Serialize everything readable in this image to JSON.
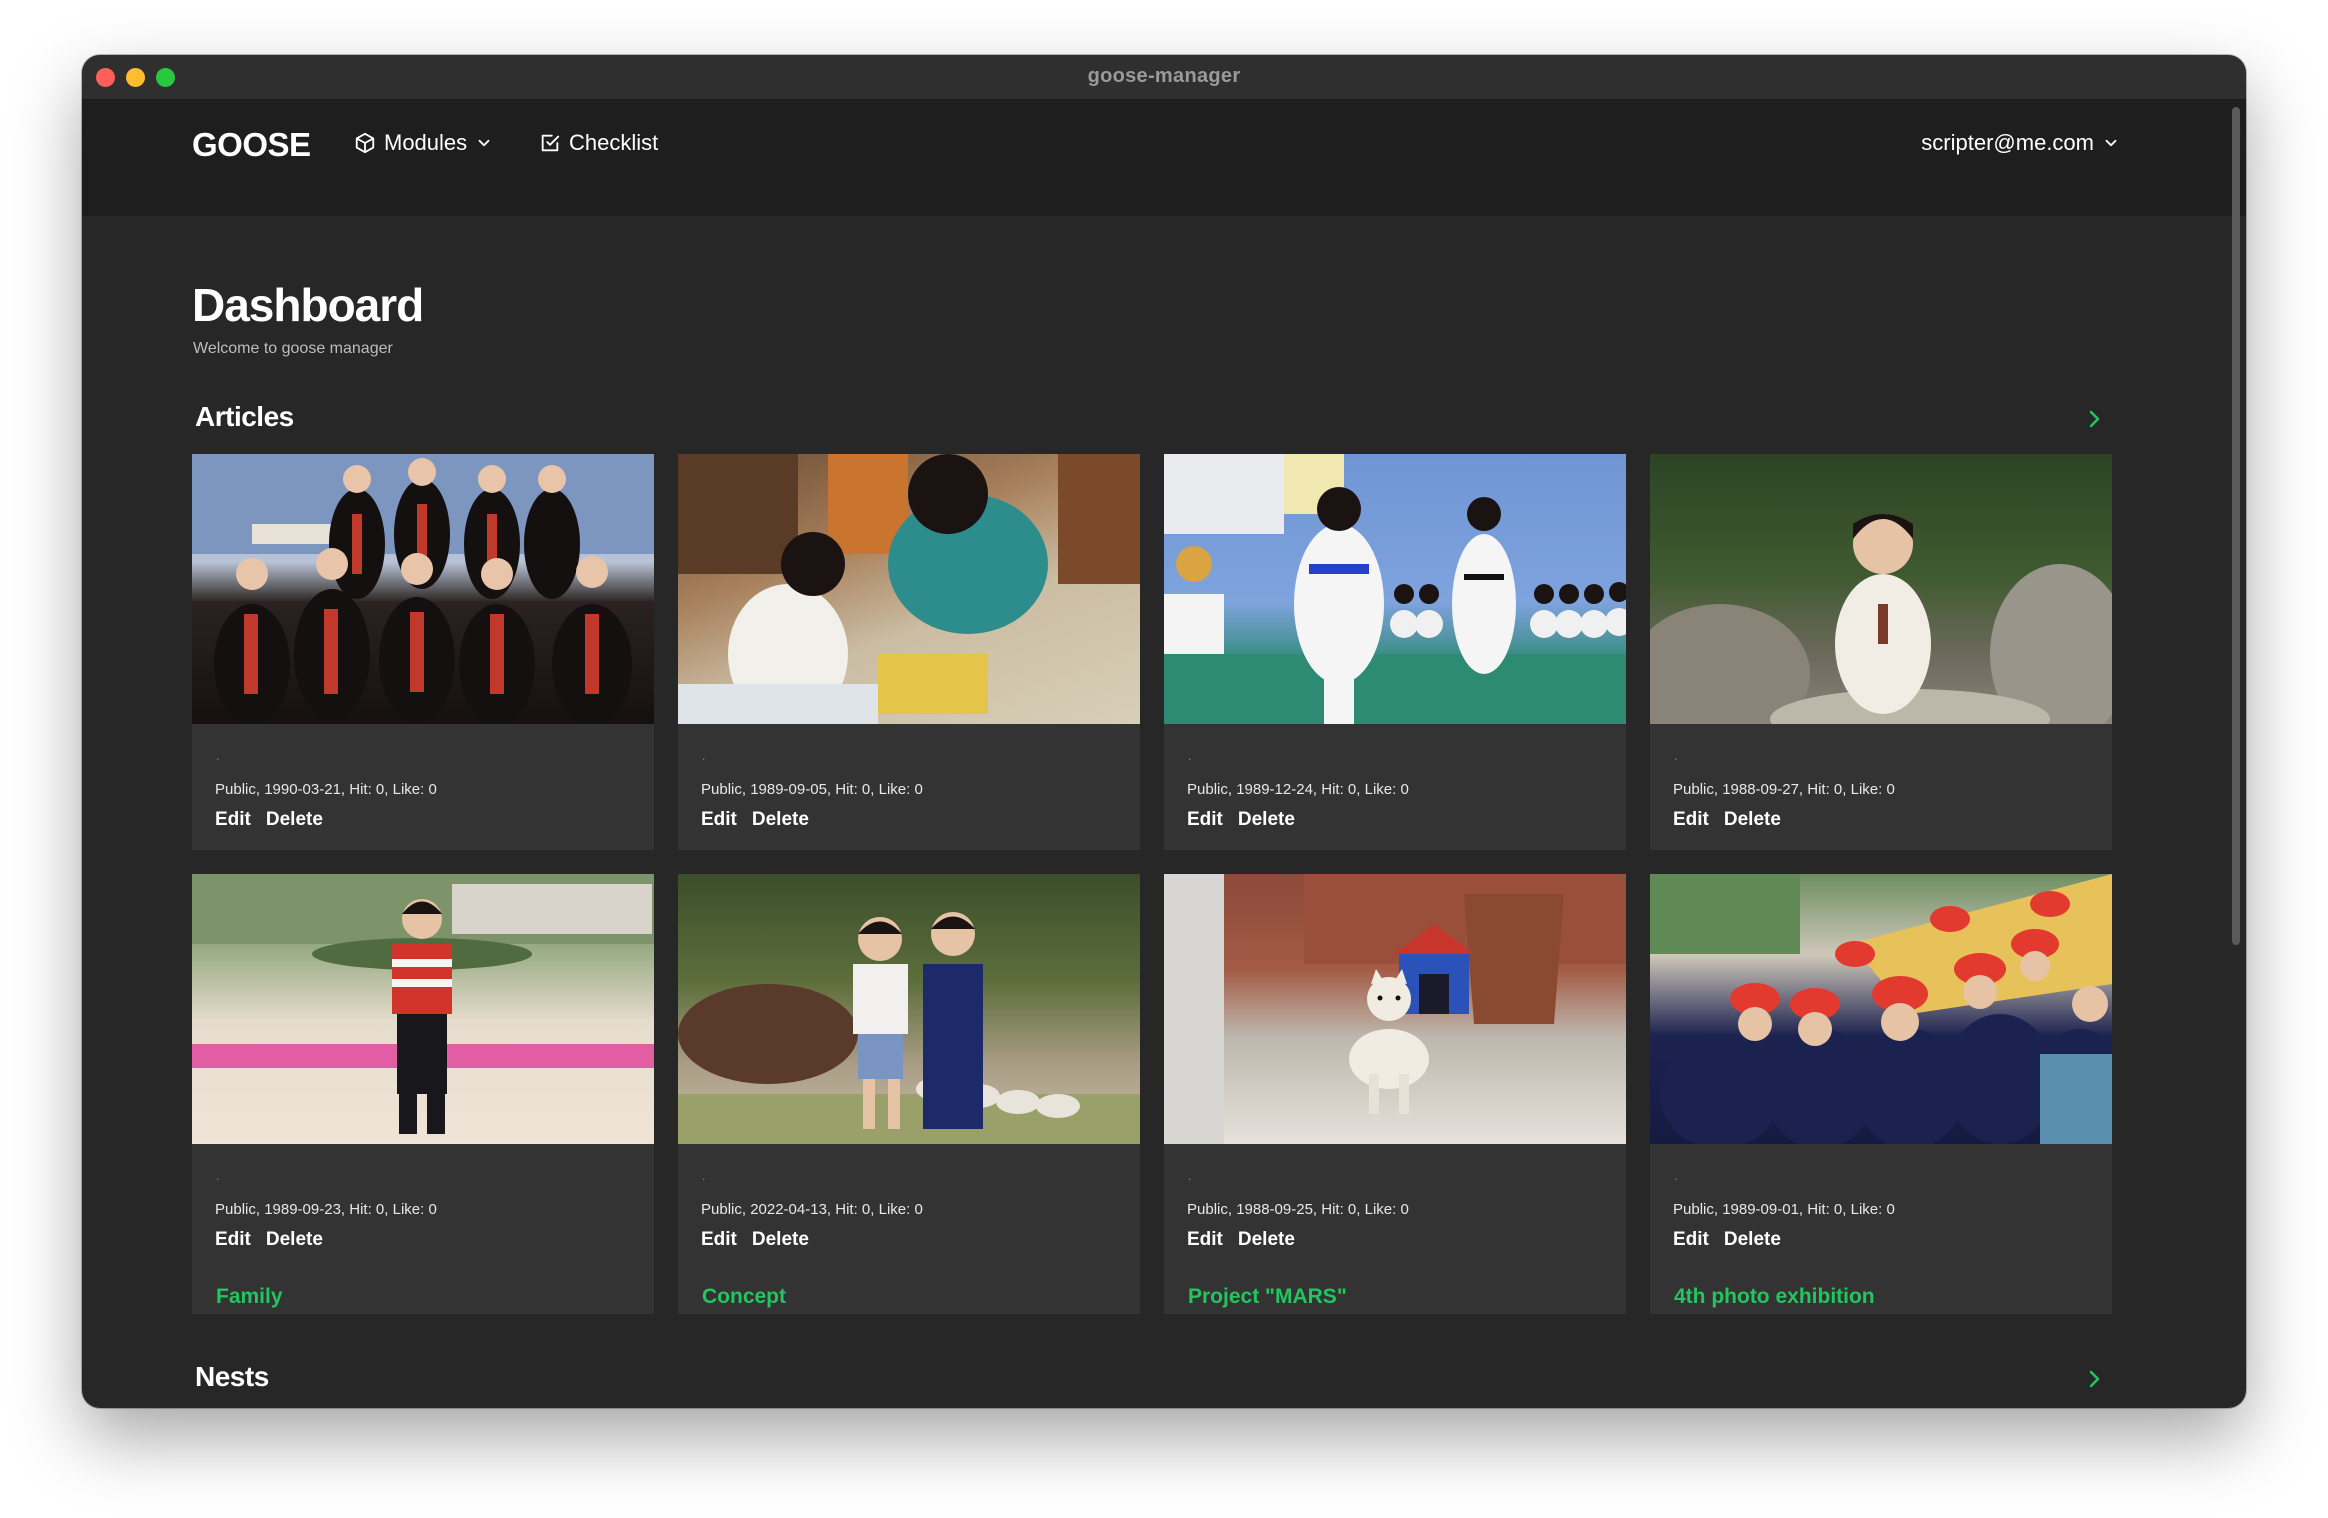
{
  "window": {
    "title": "goose-manager"
  },
  "navbar": {
    "brand": "GOOSE",
    "modules_label": "Modules",
    "checklist_label": "Checklist",
    "user_email": "scripter@me.com"
  },
  "page": {
    "title": "Dashboard",
    "subtitle": "Welcome to goose manager"
  },
  "articles": {
    "title": "Articles",
    "items": [
      {
        "title": ".",
        "meta": "Public, 1990-03-21, Hit: 0, Like: 0",
        "edit": "Edit",
        "delete": "Delete"
      },
      {
        "title": ".",
        "meta": "Public, 1989-09-05, Hit: 0, Like: 0",
        "edit": "Edit",
        "delete": "Delete"
      },
      {
        "title": ".",
        "meta": "Public, 1989-12-24, Hit: 0, Like: 0",
        "edit": "Edit",
        "delete": "Delete"
      },
      {
        "title": ".",
        "meta": "Public, 1988-09-27, Hit: 0, Like: 0",
        "edit": "Edit",
        "delete": "Delete"
      },
      {
        "title": ".",
        "meta": "Public, 1989-09-23, Hit: 0, Like: 0",
        "edit": "Edit",
        "delete": "Delete"
      },
      {
        "title": ".",
        "meta": "Public, 2022-04-13, Hit: 0, Like: 0",
        "edit": "Edit",
        "delete": "Delete"
      },
      {
        "title": ".",
        "meta": "Public, 1988-09-25, Hit: 0, Like: 0",
        "edit": "Edit",
        "delete": "Delete"
      },
      {
        "title": ".",
        "meta": "Public, 1989-09-01, Hit: 0, Like: 0",
        "edit": "Edit",
        "delete": "Delete"
      }
    ]
  },
  "nests": {
    "title": "Nests",
    "items": [
      {
        "title": "Family"
      },
      {
        "title": "Concept"
      },
      {
        "title": "Project \"MARS\""
      },
      {
        "title": "4th photo exhibition"
      }
    ]
  },
  "icons": {
    "modules": "cube-icon",
    "checklist": "checkbox-icon",
    "chevron": "chevron-down-icon",
    "section_arrow": "chevron-right-icon"
  },
  "colors": {
    "background": "#272727",
    "navbar": "#1e1e1e",
    "card": "#333333",
    "accent": "#22c55e"
  }
}
